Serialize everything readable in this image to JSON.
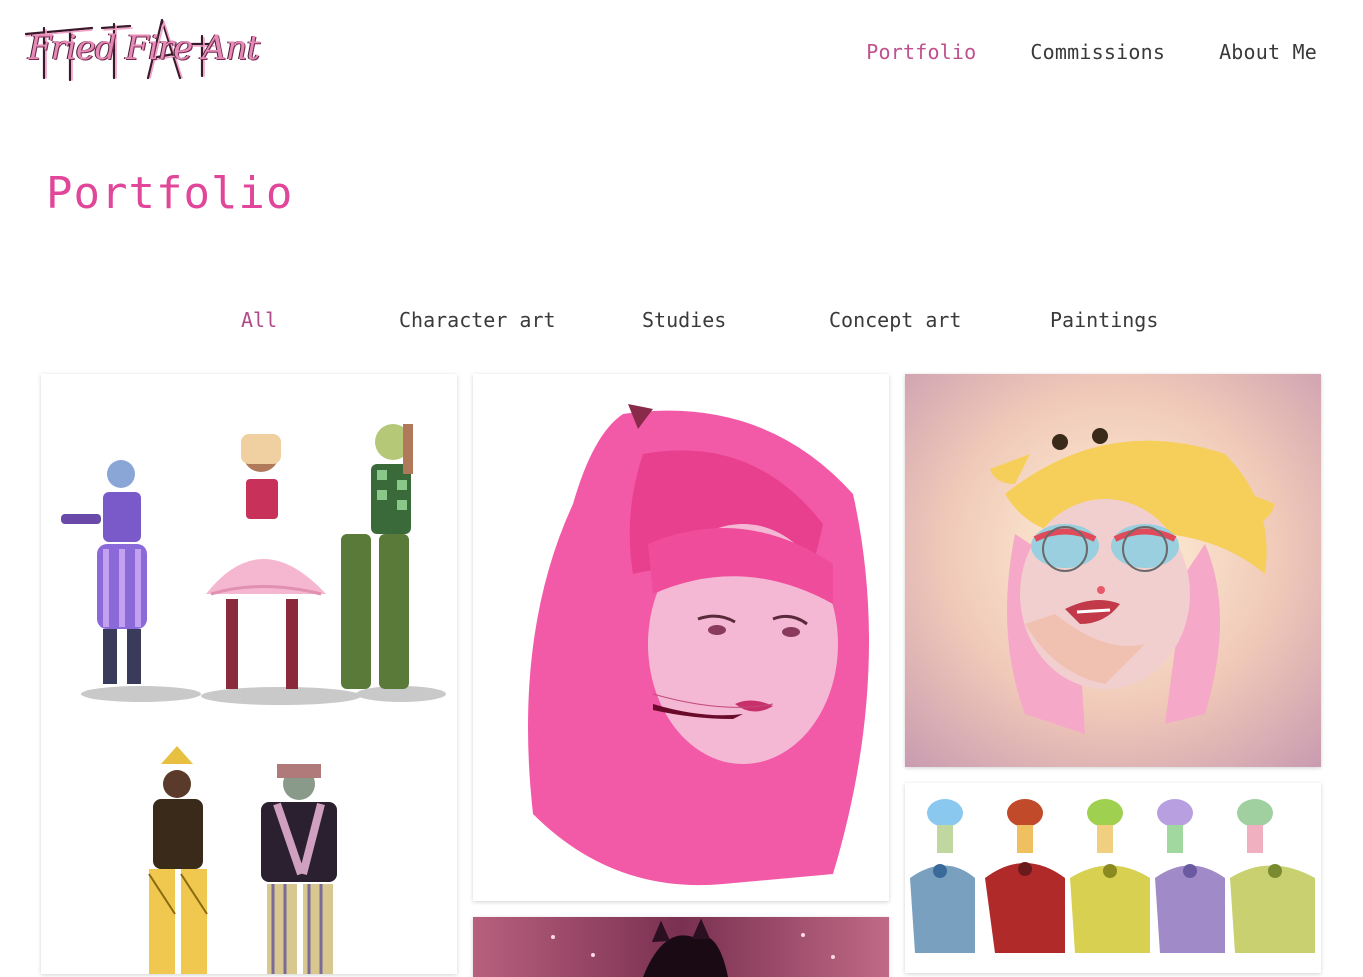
{
  "header": {
    "logo_alt": "Fried Fire Ant",
    "nav": [
      {
        "label": "Portfolio",
        "active": true
      },
      {
        "label": "Commissions",
        "active": false
      },
      {
        "label": "About Me",
        "active": false
      }
    ]
  },
  "page": {
    "title": "Portfolio"
  },
  "filters": [
    {
      "label": "All",
      "active": true
    },
    {
      "label": "Character art",
      "active": false
    },
    {
      "label": "Studies",
      "active": false
    },
    {
      "label": "Concept art",
      "active": false
    },
    {
      "label": "Paintings",
      "active": false
    }
  ],
  "gallery": [
    {
      "id": "character-lineup"
    },
    {
      "id": "pink-hair-portrait"
    },
    {
      "id": "pikachu-hat-painting"
    },
    {
      "id": "frog-creatures"
    },
    {
      "id": "dark-figure-painting"
    }
  ],
  "colors": {
    "accent": "#e0479a",
    "nav_active": "#c0508e",
    "text": "#3a3a3a"
  }
}
